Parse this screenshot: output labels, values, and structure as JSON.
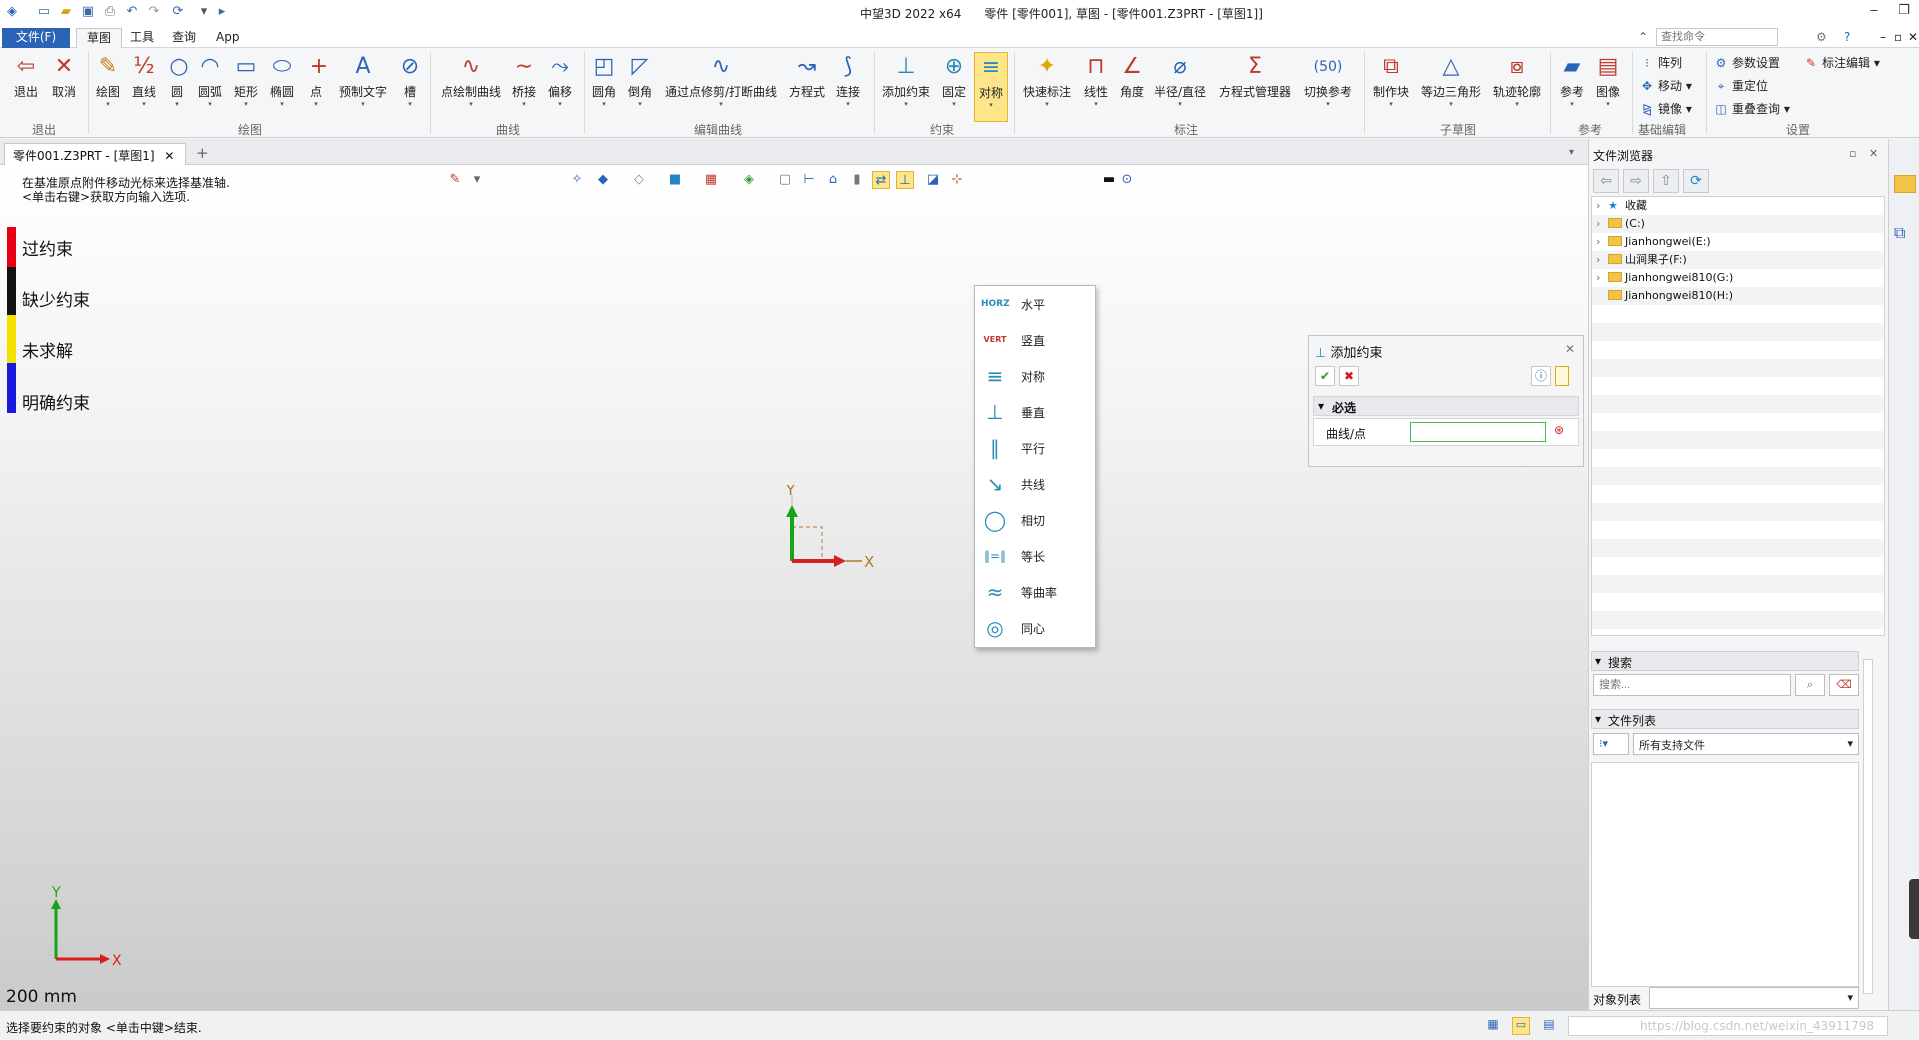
{
  "app": {
    "title": "中望3D 2022 x64      零件 [零件001], 草图 - [零件001.Z3PRT - [草图1]]"
  },
  "menu": {
    "file": "文件(F)",
    "tabs": [
      "草图",
      "工具",
      "查询",
      "App"
    ],
    "search_placeholder": "查找命令"
  },
  "ribbon": {
    "exit": "退出",
    "cancel": "取消",
    "draw": "绘图",
    "line": "直线",
    "circle": "圆",
    "arc": "圆弧",
    "rect": "矩形",
    "ellipse": "椭圆",
    "point": "点",
    "text": "预制文字",
    "slot": "槽",
    "pt_curve": "点绘制曲线",
    "bridge": "桥接",
    "offset": "偏移",
    "fillet": "圆角",
    "chamfer": "倒角",
    "trim": "通过点修剪/打断曲线",
    "equation": "方程式",
    "connect": "连接",
    "add_constraint": "添加约束",
    "fix": "固定",
    "symmetric": "对称",
    "quick_dim": "快速标注",
    "linear": "线性",
    "angle": "角度",
    "radius": "半径/直径",
    "eq_manager": "方程式管理器",
    "toggle_ref": "切换参考",
    "make_block": "制作块",
    "equi_tri": "等边三角形",
    "trace": "轨迹轮廓",
    "reference": "参考",
    "image": "图像",
    "array": "阵列",
    "move": "移动",
    "mirror": "镜像",
    "param_settings": "参数设置",
    "reposition": "重定位",
    "overlap_query": "重叠查询",
    "dim_edit": "标注编辑",
    "groups": {
      "exit": "退出",
      "draw": "绘图",
      "curve": "曲线",
      "edit_curve": "编辑曲线",
      "constraint": "约束",
      "dimension": "标注",
      "subdrawing": "子草图",
      "reference": "参考",
      "basic_edit": "基础编辑",
      "settings": "设置"
    }
  },
  "doc_tab": "零件001.Z3PRT - [草图1]",
  "viewport": {
    "hint1": "在基准原点附件移动光标来选择基准轴.",
    "hint2": "<单击右键>获取方向输入选项.",
    "legend": [
      {
        "label": "过约束",
        "color": "#e60012"
      },
      {
        "label": "缺少约束",
        "color": "#111111"
      },
      {
        "label": "未求解",
        "color": "#f5e100"
      },
      {
        "label": "明确约束",
        "color": "#1a1adf"
      }
    ],
    "axis_x": "X",
    "axis_y": "Y",
    "scale": "200 mm"
  },
  "constraint_menu": {
    "items": [
      {
        "label": "水平",
        "icon": "HORZ"
      },
      {
        "label": "竖直",
        "icon": "VERT"
      },
      {
        "label": "对称",
        "icon": "≡"
      },
      {
        "label": "垂直",
        "icon": "⊥"
      },
      {
        "label": "平行",
        "icon": "∥"
      },
      {
        "label": "共线",
        "icon": "↘"
      },
      {
        "label": "相切",
        "icon": "◯"
      },
      {
        "label": "等长",
        "icon": "‖=‖"
      },
      {
        "label": "等曲率",
        "icon": "≈"
      },
      {
        "label": "同心",
        "icon": "◎"
      }
    ]
  },
  "add_constraint_panel": {
    "title": "添加约束",
    "section": "必选",
    "field_label": "曲线/点"
  },
  "file_browser": {
    "title": "文件浏览器",
    "tree": [
      {
        "label": "收藏",
        "type": "star"
      },
      {
        "label": "(C:)",
        "type": "folder"
      },
      {
        "label": "Jianhongwei(E:)",
        "type": "folder"
      },
      {
        "label": "山涧果子(F:)",
        "type": "folder"
      },
      {
        "label": "Jianhongwei810(G:)",
        "type": "folder"
      },
      {
        "label": "Jianhongwei810(H:)",
        "type": "folder"
      }
    ],
    "search_head": "搜索",
    "search_placeholder": "搜索...",
    "filelist_head": "文件列表",
    "filter": "所有支持文件",
    "object_list": "对象列表"
  },
  "status": {
    "message": "选择要约束的对象 <单击中键>结束.",
    "watermark": "https://blog.csdn.net/weixin_43911798"
  }
}
